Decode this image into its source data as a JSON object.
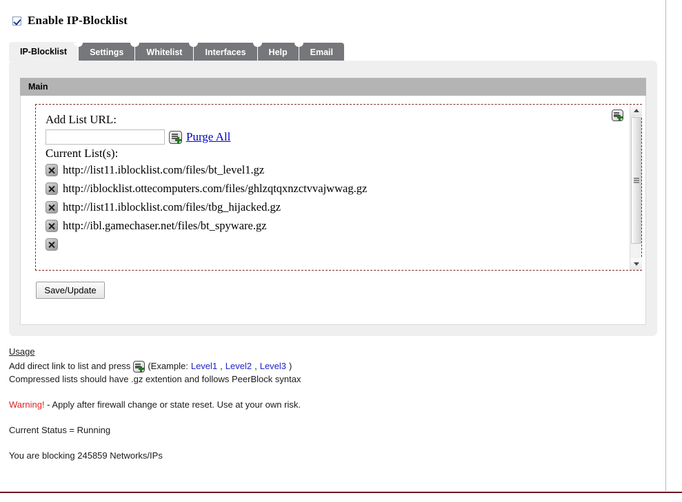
{
  "header": {
    "checkbox_checked": true,
    "label": "Enable IP-Blocklist"
  },
  "tabs": [
    {
      "label": "IP-Blocklist",
      "active": true
    },
    {
      "label": "Settings",
      "active": false
    },
    {
      "label": "Whitelist",
      "active": false
    },
    {
      "label": "Interfaces",
      "active": false
    },
    {
      "label": "Help",
      "active": false
    },
    {
      "label": "Email",
      "active": false
    }
  ],
  "panel": {
    "title": "Main",
    "add_url_label": "Add List URL:",
    "url_input_value": "",
    "url_input_placeholder": "",
    "purge_all_label": "Purge All",
    "current_lists_label": "Current List(s):",
    "lists": [
      "http://list11.iblocklist.com/files/bt_level1.gz",
      "http://iblocklist.ottecomputers.com/files/ghlzqtqxnzctvvajwwag.gz",
      "http://list11.iblocklist.com/files/tbg_hijacked.gz",
      "http://ibl.gamechaser.net/files/bt_spyware.gz",
      ""
    ],
    "save_label": "Save/Update",
    "add_icon_name": "add-list-icon",
    "delete_icon_name": "delete-list-icon"
  },
  "usage": {
    "title": "Usage",
    "line1_before": "Add direct link to list and press",
    "line1_after_open": "(Example:",
    "examples": [
      "Level1",
      "Level2",
      "Level3"
    ],
    "line1_after_close": ")",
    "line2": "Compressed lists should have .gz extention and follows PeerBlock syntax",
    "warning_word": "Warning!",
    "warning_rest": "- Apply after firewall change or state reset. Use at your own risk.",
    "status": "Current Status = Running",
    "blocking": "You are blocking 245859 Networks/IPs"
  },
  "colors": {
    "tab_inactive": "#76777a",
    "tab_active": "#efefef",
    "panel_header": "#b4b4b4",
    "dashed_border": "#7a2b2b",
    "link_blue": "#0000c8",
    "warning_red": "#e02020",
    "bottom_rule": "#6b1620"
  }
}
